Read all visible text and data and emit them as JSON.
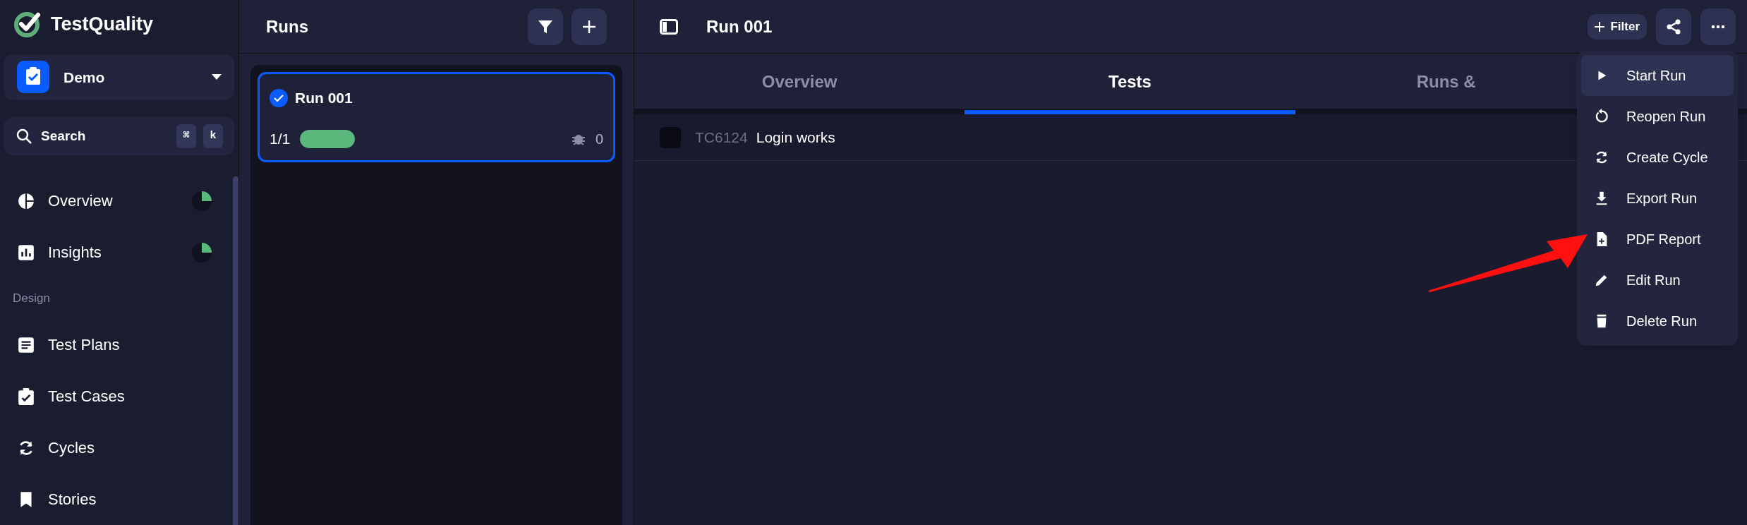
{
  "app": {
    "name": "TestQuality"
  },
  "project": {
    "name": "Demo"
  },
  "search": {
    "label": "Search",
    "keys": [
      "⌘",
      "k"
    ]
  },
  "nav": [
    {
      "kind": "link",
      "label": "Overview",
      "progress": true
    },
    {
      "kind": "link",
      "label": "Insights",
      "progress": true
    },
    {
      "kind": "section",
      "label": "Design"
    },
    {
      "kind": "link",
      "label": "Test Plans",
      "progress": false
    },
    {
      "kind": "link",
      "label": "Test Cases",
      "progress": false
    },
    {
      "kind": "link",
      "label": "Cycles",
      "progress": false
    },
    {
      "kind": "link",
      "label": "Stories",
      "progress": false
    }
  ],
  "runs": {
    "title": "Runs",
    "items": [
      {
        "name": "Run 001",
        "selected": true,
        "count": "1/1",
        "level": 1,
        "defects": "0"
      }
    ]
  },
  "run": {
    "title": "Run 001",
    "filter": "Filter",
    "tabs": [
      {
        "label": "Overview",
        "selected": false
      },
      {
        "label": "Tests",
        "selected": true
      },
      {
        "label": "Runs &",
        "selected": false
      }
    ],
    "tests": [
      {
        "id": "TC6124",
        "name": "Login works",
        "checked": false
      }
    ]
  },
  "menu": [
    {
      "label": "Start Run",
      "selected": true
    },
    {
      "label": "Reopen Run",
      "selected": false
    },
    {
      "label": "Create Cycle",
      "selected": false
    },
    {
      "label": "Export Run",
      "selected": false
    },
    {
      "label": "PDF Report",
      "selected": false
    },
    {
      "label": "Edit Run",
      "selected": false
    },
    {
      "label": "Delete Run",
      "selected": false
    }
  ]
}
